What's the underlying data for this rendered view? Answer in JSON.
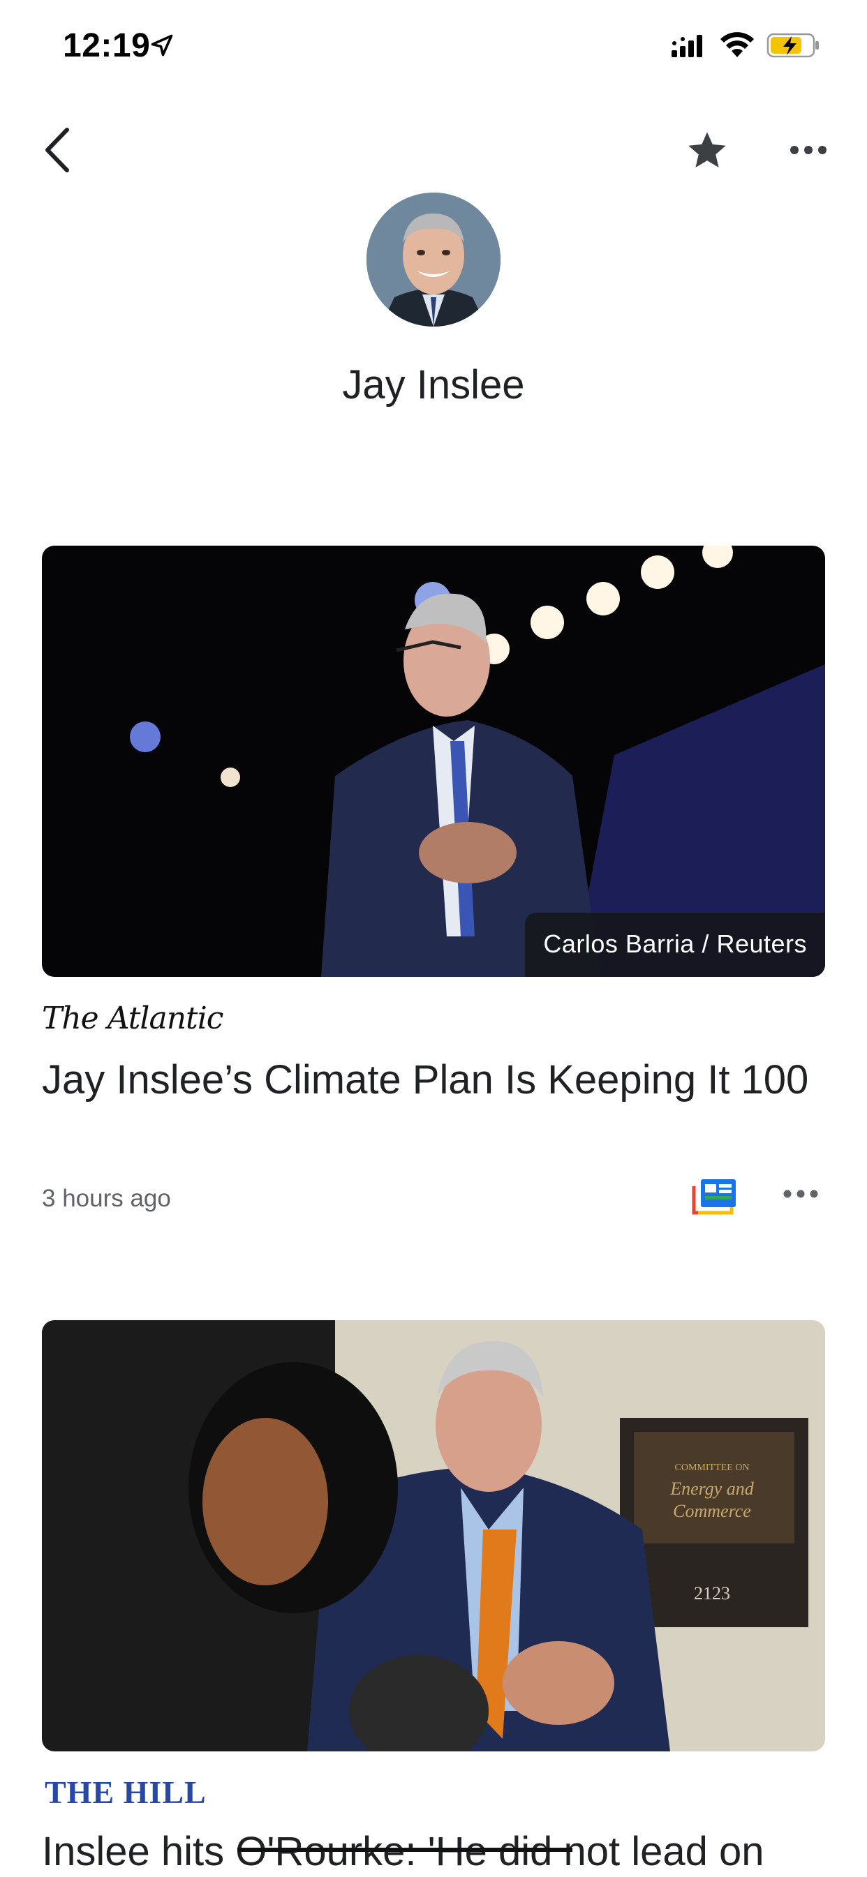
{
  "status_bar": {
    "time": "12:19",
    "icons": [
      "location-icon",
      "signal-icon",
      "wifi-icon",
      "battery-charging-icon"
    ]
  },
  "header": {
    "back_icon": "chevron-left-icon",
    "star_icon": "star-icon",
    "more_icon": "more-horizontal-icon"
  },
  "topic": {
    "name": "Jay Inslee"
  },
  "articles": [
    {
      "photo_credit": "Carlos Barria / Reuters",
      "publisher": "The Atlantic",
      "headline": "Jay Inslee’s Climate Plan Is Keeping It 100",
      "time": "3 hours ago",
      "actions": [
        "full-coverage-icon",
        "more-horizontal-icon"
      ]
    },
    {
      "publisher": "THE HILL",
      "headline": "Inslee hits O'Rourke: 'He did not lead on"
    }
  ],
  "colors": {
    "text_primary": "#202124",
    "text_secondary": "#5f6368",
    "hill_blue": "#2848a6",
    "battery_yellow": "#f4c400",
    "coverage_blue": "#1a73e8",
    "coverage_green": "#34a853",
    "coverage_red": "#ea4335",
    "coverage_yellow": "#fbbc04"
  }
}
